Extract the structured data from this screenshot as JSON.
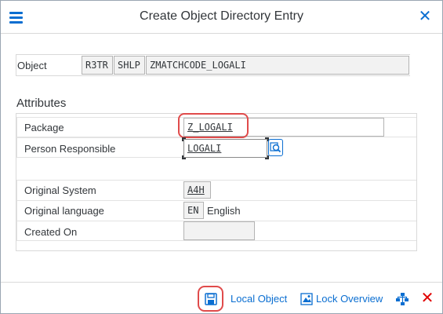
{
  "window": {
    "title": "Create Object Directory Entry"
  },
  "object": {
    "label": "Object",
    "pgmid": "R3TR",
    "type": "SHLP",
    "name": "ZMATCHCODE_LOGALI"
  },
  "attributes": {
    "section_title": "Attributes",
    "package_label": "Package",
    "package_value": "Z_LOGALI",
    "person_label": "Person Responsible",
    "person_value": "LOGALI",
    "orig_system_label": "Original System",
    "orig_system_value": "A4H",
    "orig_lang_label": "Original language",
    "orig_lang_code": "EN",
    "orig_lang_text": "English",
    "created_on_label": "Created On",
    "created_on_value": ""
  },
  "footer": {
    "local_object_label": "Local Object",
    "lock_overview_label": "Lock Overview"
  },
  "colors": {
    "accent": "#0a6ed1",
    "highlight": "#e04b4b",
    "cancel": "#e00000"
  },
  "icons": [
    "menu-icon",
    "close-icon",
    "value-help-icon",
    "save-icon",
    "lock-overview-icon",
    "hierarchy-icon",
    "cancel-icon"
  ]
}
